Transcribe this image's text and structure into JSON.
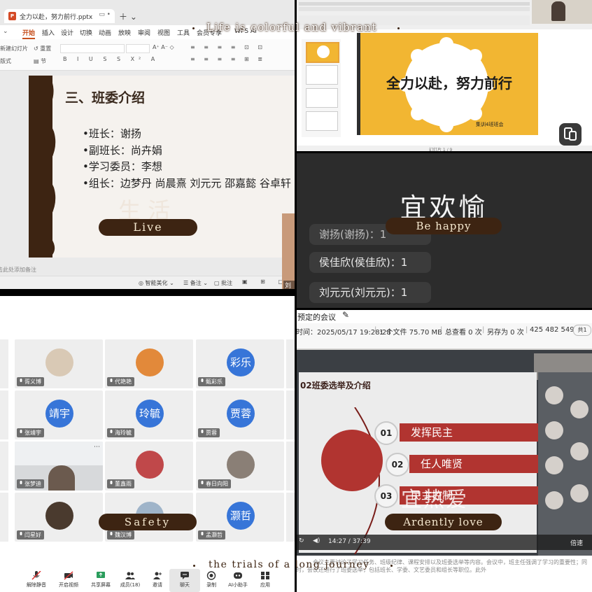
{
  "overlay": {
    "headline": "Life is colorful and vibrant",
    "footer": "the trials of a long journey"
  },
  "presentation": {
    "file_tab": "全力以赴，努力前行.pptx",
    "menu": [
      "开始",
      "插入",
      "设计",
      "切换",
      "动画",
      "放映",
      "审阅",
      "视图",
      "工具",
      "会员专享",
      "WPS AI"
    ],
    "ribbon": {
      "new_slide": "新建幻灯片",
      "reset": "重置",
      "layout": "版式",
      "section": "节"
    },
    "slide": {
      "title": "三、班委介绍",
      "bullets": [
        "•班长：谢扬",
        "•副班长：尚卉娟",
        "•学习委员：李想",
        "•组长：边梦丹  尚晨熹  刘元元   邵嘉懿  谷卓轩"
      ],
      "ghost": "生 活",
      "pill": "Live"
    },
    "note_placeholder": "单击此处添加备注",
    "status": {
      "beautify": "智能美化",
      "notes": "备注",
      "comments": "批注"
    },
    "participant_name": "刘元"
  },
  "wps_thumb": {
    "slide_title": "全力以赴，努力前行",
    "slide_sub": "集训4班班会",
    "thumb_text": "全力以赴，努力前行",
    "status": "幻灯片 1 / 9"
  },
  "message_panel": {
    "title": "宜欢愉",
    "pill": "Be happy",
    "rows": [
      {
        "text": "谢扬(谢扬)：1"
      },
      {
        "text": "侯佳欣(侯佳欣)：1"
      },
      {
        "text": "刘元元(刘元元)：1"
      }
    ]
  },
  "meeting": {
    "participants": [
      {
        "name": "胥义博",
        "avatar_type": "photo",
        "avatar_color": "#d9c9b5"
      },
      {
        "name": "代艳艳",
        "avatar_type": "photo",
        "avatar_color": "#e2893a"
      },
      {
        "name": "甄彩乐",
        "avatar_type": "text",
        "avatar_text": "彩乐"
      },
      {
        "name": "张靖宇",
        "avatar_type": "text",
        "avatar_text": "靖宇"
      },
      {
        "name": "海玲毓",
        "avatar_type": "text",
        "avatar_text": "玲毓"
      },
      {
        "name": "贾蓉",
        "avatar_type": "text",
        "avatar_text": "贾蓉"
      },
      {
        "name": "张梦迪",
        "avatar_type": "video",
        "avatar_color": "#bcc0c4"
      },
      {
        "name": "董鑫雨",
        "avatar_type": "photo",
        "avatar_color": "#c0484a"
      },
      {
        "name": "春日向阳",
        "avatar_type": "photo",
        "avatar_color": "#8a7f76"
      },
      {
        "name": "闫星好",
        "avatar_type": "photo",
        "avatar_color": "#4a3a2e"
      },
      {
        "name": "魏汉博",
        "avatar_type": "photo",
        "avatar_color": "#9fb4c9"
      },
      {
        "name": "孟灏哲",
        "avatar_type": "text",
        "avatar_text": "灏哲"
      }
    ],
    "pill": "Safety",
    "toolbar": [
      {
        "label": "解除静音",
        "icon": "mic-muted-icon"
      },
      {
        "label": "开启视频",
        "icon": "camera-off-icon"
      },
      {
        "label": "共享屏幕",
        "icon": "share-screen-icon"
      },
      {
        "label": "成员(18)",
        "icon": "members-icon"
      },
      {
        "label": "邀请",
        "icon": "invite-icon"
      },
      {
        "label": "聊天",
        "icon": "chat-icon"
      },
      {
        "label": "录制",
        "icon": "record-icon"
      },
      {
        "label": "AI小助手",
        "icon": "ai-assistant-icon"
      },
      {
        "label": "应用",
        "icon": "apps-icon"
      }
    ]
  },
  "recording": {
    "title": "预定的会议",
    "time": "时间：2025/05/17 19:28:28",
    "files": "1 个文件 75.70 MB",
    "views": "总查看 0 次",
    "saves": "另存为 0 次",
    "id": "425 482 549",
    "shared": "共1",
    "ppt_title": "02班委选举及介绍",
    "items": [
      {
        "num": "01",
        "text": "发挥民主"
      },
      {
        "num": "02",
        "text": "任人唯贤"
      },
      {
        "num": "03",
        "text": "民主控制"
      }
    ],
    "overlay_text": "宜热爱",
    "pill": "Ardently love",
    "playback": "14:27 / 37:39",
    "speed": "倍速",
    "summary": "会议主要讨论了学习任务、班级纪律、课程安排以及班委选举等内容。会议中，班主任强调了学习的重要性；同时，会议还进行了班委选举，包括班长、学委、文艺委员和组长等职位。此外"
  }
}
